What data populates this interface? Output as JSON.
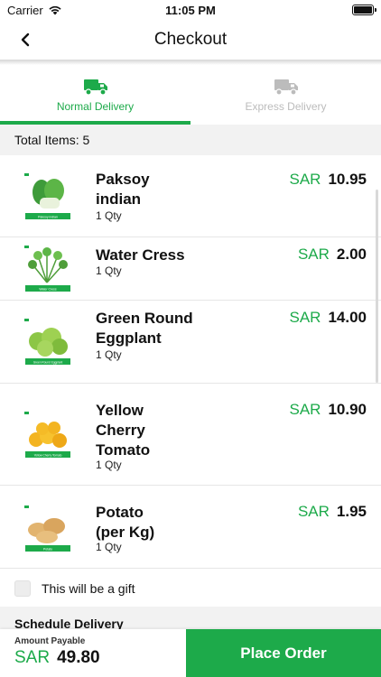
{
  "status": {
    "carrier": "Carrier",
    "time": "11:05 PM"
  },
  "nav": {
    "title": "Checkout"
  },
  "tabs": [
    {
      "label": "Normal Delivery",
      "active": true
    },
    {
      "label": "Express Delivery",
      "active": false
    }
  ],
  "summary": {
    "total_items": "Total Items: 5"
  },
  "items": [
    {
      "name_lines": [
        "Paksoy",
        "indian"
      ],
      "qty": "1 Qty",
      "currency": "SAR",
      "price": "10.95",
      "thumb_caption": "Paksoy indian"
    },
    {
      "name_lines": [
        "Water Cress"
      ],
      "qty": "1 Qty",
      "currency": "SAR",
      "price": "2.00",
      "thumb_caption": "Water Cress"
    },
    {
      "name_lines": [
        "Green Round",
        "Eggplant"
      ],
      "qty": "1 Qty",
      "currency": "SAR",
      "price": "14.00",
      "thumb_caption": "Green Round Eggplant"
    },
    {
      "name_lines": [
        "Yellow",
        "Cherry",
        "Tomato"
      ],
      "qty": "1 Qty",
      "currency": "SAR",
      "price": "10.90",
      "thumb_caption": "Yellow Cherry Tomato"
    },
    {
      "name_lines": [
        "Potato",
        "(per Kg)"
      ],
      "qty": "1 Qty",
      "currency": "SAR",
      "price": "1.95",
      "thumb_caption": "Potato"
    }
  ],
  "gift": {
    "label": "This will be a gift",
    "checked": false
  },
  "schedule": {
    "title": "Schedule Delivery"
  },
  "footer": {
    "amount_label": "Amount Payable",
    "currency": "SAR",
    "amount": "49.80",
    "button_label": "Place Order"
  },
  "colors": {
    "accent": "#1daa4a",
    "muted": "#bcbcbc",
    "section_bg": "#f2f2f2"
  }
}
